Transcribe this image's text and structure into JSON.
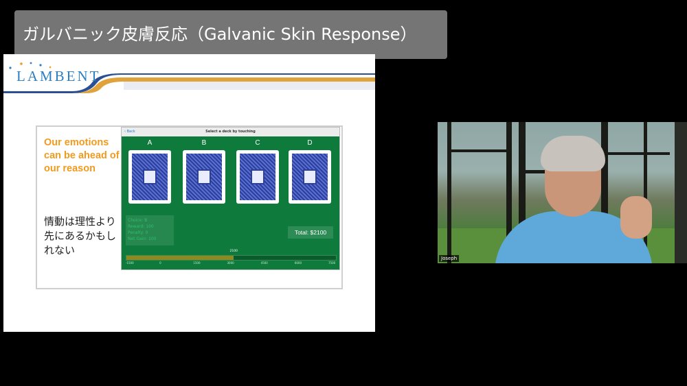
{
  "caption": {
    "text": "ガルバニック皮膚反応（Galvanic Skin Response）"
  },
  "slide": {
    "logo": "LAMBENT",
    "english_text": "Our emotions can be ahead of our reason",
    "japanese_text": "情動は理性より先にあるかもしれない",
    "game": {
      "back_label": "‹ Back",
      "title": "Select a deck by touching",
      "decks": [
        "A",
        "B",
        "C",
        "D"
      ],
      "stats": [
        "Choice: B",
        "Reward: 100",
        "Penalty: 0",
        "Net Gain: 100"
      ],
      "total": "Total: $2100",
      "progress": {
        "value": 2100,
        "marker_label": "2100",
        "fraction": 0.51
      },
      "bar_ticks": [
        "-1500",
        "0",
        "1500",
        "3000",
        "4500",
        "6000",
        "7500"
      ]
    }
  },
  "video": {
    "participant_name": "Joseph"
  }
}
